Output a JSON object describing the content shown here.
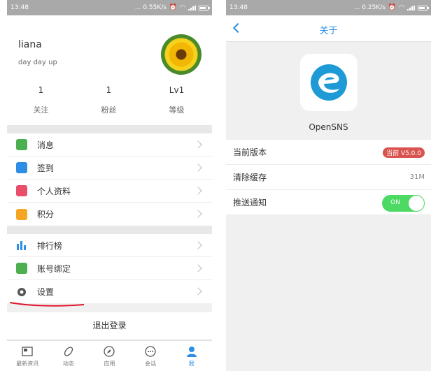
{
  "left": {
    "status": {
      "time": "13:48",
      "net": "... 0.55K/s"
    },
    "profile": {
      "name": "liana",
      "motto": "day day up"
    },
    "stats": [
      {
        "value": "1",
        "label": "关注"
      },
      {
        "value": "1",
        "label": "粉丝"
      },
      {
        "value": "Lv1",
        "label": "等级"
      }
    ],
    "menu1": [
      {
        "label": "消息",
        "icon": "message-icon",
        "color": "#4caf50"
      },
      {
        "label": "签到",
        "icon": "checkin-icon",
        "color": "#2d8ee4"
      },
      {
        "label": "个人资料",
        "icon": "profile-card-icon",
        "color": "#e94f6b"
      },
      {
        "label": "积分",
        "icon": "points-icon",
        "color": "#f5a623"
      }
    ],
    "menu2": [
      {
        "label": "排行榜",
        "icon": "ranking-icon",
        "color": "#2d8ee4"
      },
      {
        "label": "账号绑定",
        "icon": "bind-account-icon",
        "color": "#4caf50"
      },
      {
        "label": "设置",
        "icon": "settings-gear-icon",
        "color": "#555555"
      }
    ],
    "logout": "退出登录",
    "tabs": [
      {
        "label": "最新资讯",
        "icon": "news-icon"
      },
      {
        "label": "动态",
        "icon": "activity-icon"
      },
      {
        "label": "应用",
        "icon": "apps-compass-icon"
      },
      {
        "label": "会话",
        "icon": "chat-icon"
      },
      {
        "label": "我",
        "icon": "me-person-icon",
        "active": true
      }
    ]
  },
  "right": {
    "status": {
      "time": "13:48",
      "net": "... 0.25K/s"
    },
    "title": "关于",
    "app_name": "OpenSNS",
    "rows": {
      "version_label": "当前版本",
      "version_value": "当前 V5.0.0",
      "cache_label": "清除缓存",
      "cache_value": "31M",
      "push_label": "推送通知",
      "push_value": "ON"
    }
  },
  "colors": {
    "accent": "#2d8ee4",
    "toggle": "#4cd964",
    "badge": "#d9534f",
    "annotation": "#e0162b"
  }
}
